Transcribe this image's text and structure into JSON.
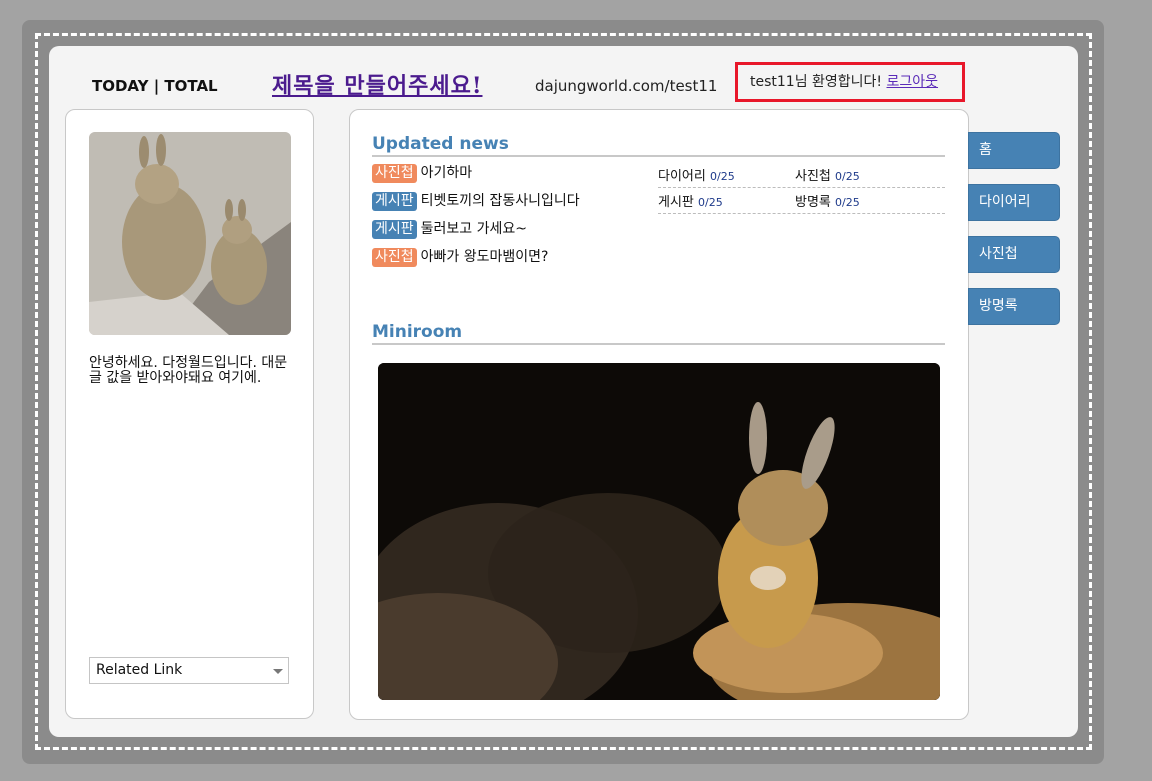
{
  "header": {
    "counter_label": "TODAY | TOTAL",
    "title": "제목을 만들어주세요!",
    "url": "dajungworld.com/test11",
    "welcome_text": "test11님 환영합니다!",
    "logout_label": "로그아웃"
  },
  "profile": {
    "intro": "안녕하세요. 다정월드입니다. 대문글 값을 받아와야돼요 여기에.",
    "related_link": "Related Link"
  },
  "updated_news": {
    "heading": "Updated news",
    "items": [
      {
        "tag": "사진첩",
        "tag_type": "photo",
        "text": "아기하마"
      },
      {
        "tag": "게시판",
        "tag_type": "board",
        "text": "티벳토끼의 잡동사니입니다"
      },
      {
        "tag": "게시판",
        "tag_type": "board",
        "text": "둘러보고 가세요~"
      },
      {
        "tag": "사진첩",
        "tag_type": "photo",
        "text": "아빠가 왕도마뱀이면?"
      }
    ],
    "stats": [
      {
        "label": "다이어리",
        "count": "0/25"
      },
      {
        "label": "사진첩",
        "count": "0/25"
      },
      {
        "label": "게시판",
        "count": "0/25"
      },
      {
        "label": "방명록",
        "count": "0/25"
      }
    ]
  },
  "miniroom": {
    "heading": "Miniroom"
  },
  "nav": {
    "items": [
      "홈",
      "다이어리",
      "사진첩",
      "방명록"
    ]
  },
  "colors": {
    "accent": "#4682b4",
    "photo_tag": "#f08a5d",
    "title": "#4b1b8e",
    "highlight_border": "#e8172a"
  }
}
